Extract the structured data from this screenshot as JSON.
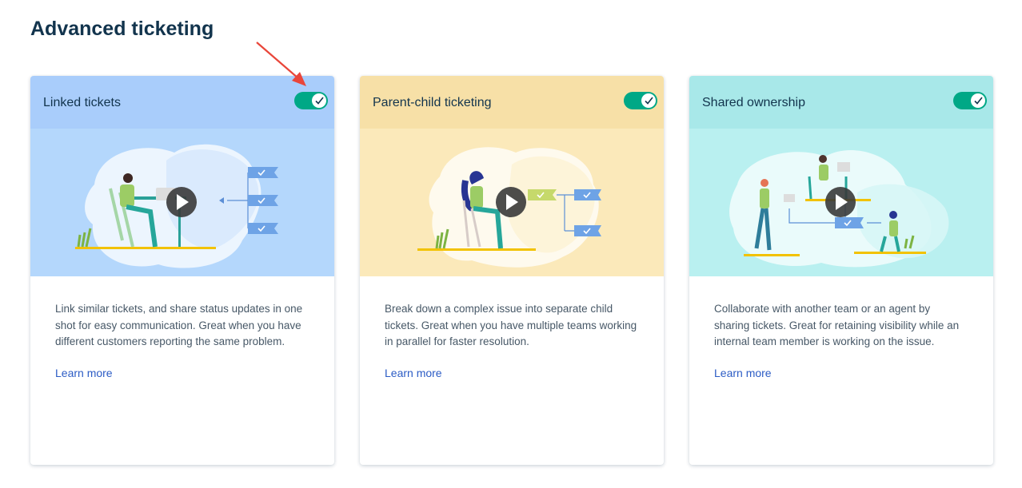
{
  "page": {
    "title": "Advanced ticketing"
  },
  "cards": [
    {
      "title": "Linked tickets",
      "description": "Link similar tickets, and share status updates in one shot for easy communication. Great when you have different customers reporting the same problem.",
      "link": "Learn more",
      "enabled": true,
      "header_color": "#a9cdfb",
      "illustration_color": "#b4d7fc"
    },
    {
      "title": "Parent-child ticketing",
      "description": "Break down a complex issue into separate child tickets. Great when you have multiple teams working in parallel for faster resolution.",
      "link": "Learn more",
      "enabled": true,
      "header_color": "#f7e0a7",
      "illustration_color": "#fbe9ba"
    },
    {
      "title": "Shared ownership",
      "description": "Collaborate with another team or an agent by sharing tickets. Great for retaining visibility while an internal team member is working on the issue.",
      "link": "Learn more",
      "enabled": true,
      "header_color": "#a8e8e9",
      "illustration_color": "#b9f0f0"
    }
  ],
  "colors": {
    "toggle_on": "#00a886",
    "link": "#2c5cc5",
    "title": "#12344d",
    "annotation_arrow": "#e9463a"
  },
  "icons": {
    "toggle": "check-icon",
    "play": "play-icon",
    "annotation": "red-arrow-icon"
  }
}
